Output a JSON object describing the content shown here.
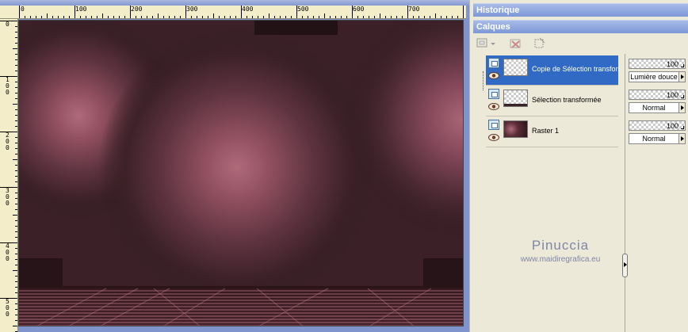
{
  "ruler": {
    "h_labels": [
      "0",
      "100",
      "200",
      "300",
      "400",
      "500",
      "600",
      "700"
    ],
    "v_labels": [
      "0",
      "1\n0\n0",
      "2\n0\n0",
      "3\n0\n0",
      "4\n0\n0",
      "5\n0\n0"
    ]
  },
  "panels": {
    "historique_title": "Historique",
    "calques_title": "Calques"
  },
  "layers": [
    {
      "name": "Copie de Sélection transformée",
      "opacity": "100",
      "blend": "Lumière douce",
      "selected": true,
      "thumb": "transparent"
    },
    {
      "name": "Sélection transformée",
      "opacity": "100",
      "blend": "Normal",
      "selected": false,
      "thumb": "selbar"
    },
    {
      "name": "Raster 1",
      "opacity": "100",
      "blend": "Normal",
      "selected": false,
      "thumb": "raster"
    }
  ],
  "watermark": {
    "name": "Pinuccia",
    "url": "www.maidiregrafica.eu"
  },
  "colors": {
    "titlebar": "#7d97d8",
    "selection": "#316ac5",
    "canvas_base": "#301a1f",
    "canvas_glow": "#b06a7a"
  },
  "icons": [
    "new-layer-icon",
    "delete-layer-icon",
    "mask-icon",
    "layer-type-icon",
    "eye-icon"
  ]
}
